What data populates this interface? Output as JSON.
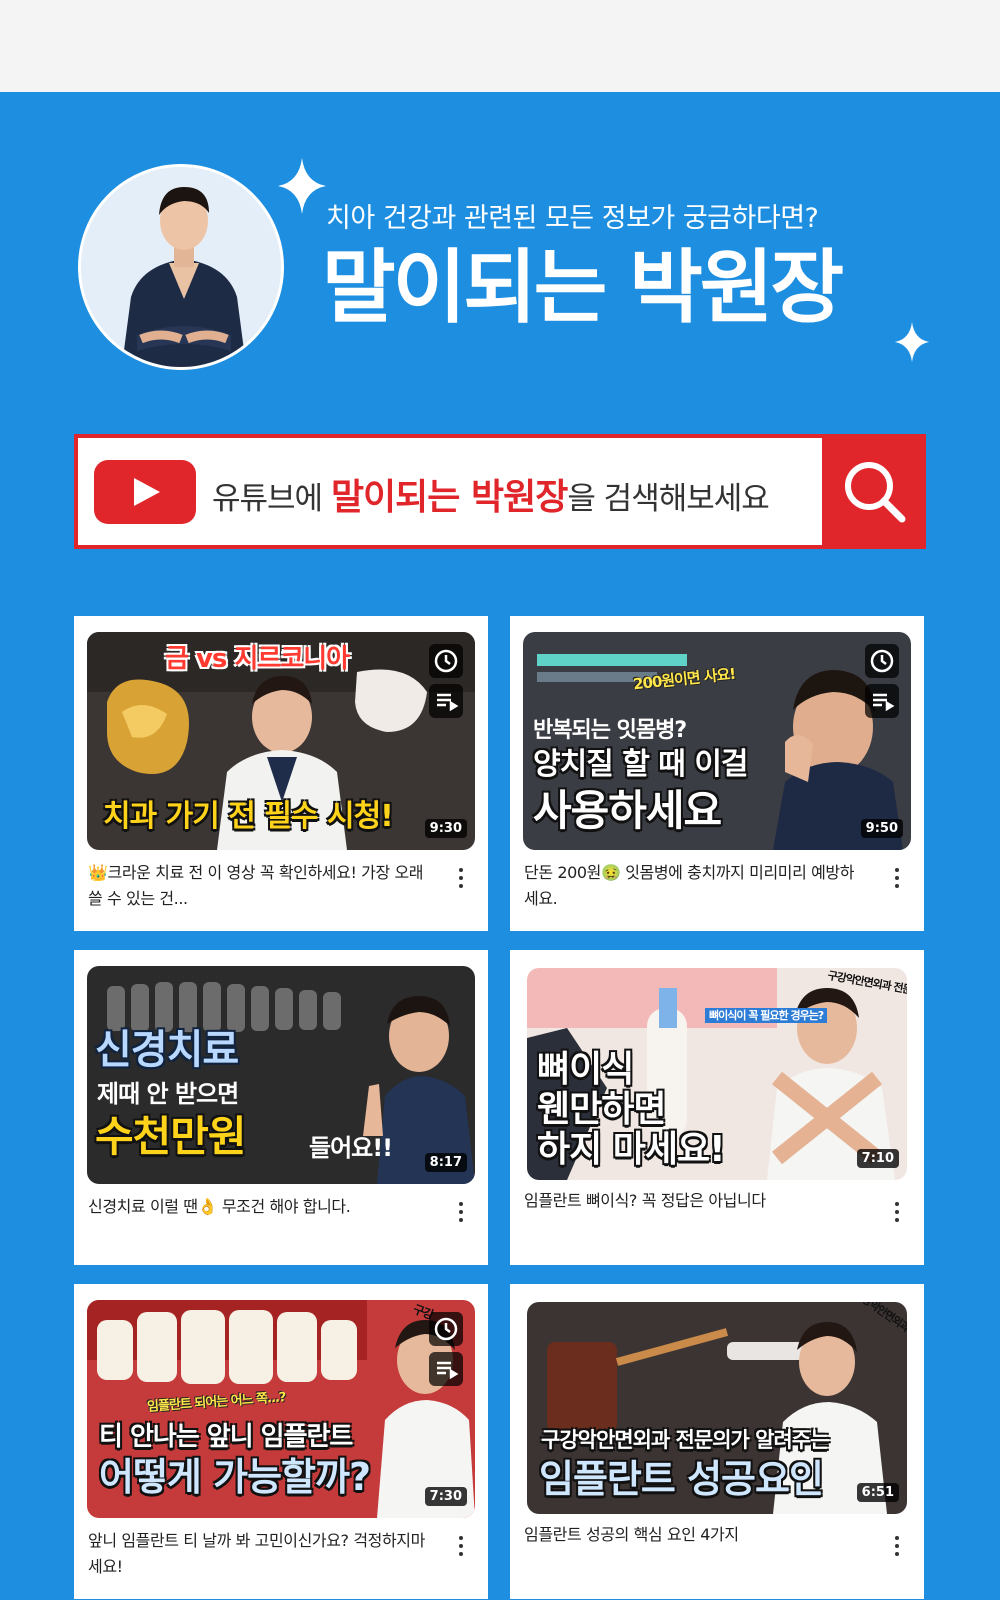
{
  "header": {
    "subtitle": "치아 건강과 관련된 모든 정보가 궁금하다면?",
    "title": "말이되는 박원장"
  },
  "search": {
    "prefix": "유튜브에 ",
    "highlight": "말이되는 박원장",
    "suffix": "을 검색해보세요"
  },
  "colors": {
    "background": "#1e8fe0",
    "accent": "#e0262b"
  },
  "videos": [
    {
      "duration": "9:30",
      "caption": "👑크라운 치료 전 이 영상 꼭 확인하세요! 가장 오래 쓸 수 있는 건...",
      "thumb_lines": [
        "금 vs 지르코니아",
        "치과 가기 전 필수 시청!"
      ]
    },
    {
      "duration": "9:50",
      "caption": "단돈 200원🤢 잇몸병에 충치까지 미리미리 예방하세요.",
      "thumb_lines": [
        "200원이면 사요!",
        "반복되는 잇몸병?",
        "양치질 할 때 이걸",
        "사용하세요"
      ]
    },
    {
      "duration": "8:17",
      "caption": "신경치료 이럴 땐👌 무조건 해야 합니다.",
      "thumb_lines": [
        "신경치료",
        "제때 안 받으면",
        "수천만원",
        "들어요!!"
      ]
    },
    {
      "duration": "7:10",
      "caption": "임플란트 뼈이식? 꼭 정답은 아닙니다",
      "thumb_lines": [
        "구강악안면외과 전문의",
        "뼈이식이 꼭 필요한 경우는?",
        "뼈이식",
        "웬만하면",
        "하지 마세요!"
      ]
    },
    {
      "duration": "7:30",
      "caption": "앞니 임플란트 티 날까 봐 고민이신가요? 걱정하지마세요!",
      "thumb_lines": [
        "구강",
        "임플란트 되어는 어느 쪽...?",
        "티 안나는 앞니 임플란트",
        "어떻게 가능할까?"
      ]
    },
    {
      "duration": "6:51",
      "caption": "임플란트 성공의 핵심 요인 4가지",
      "thumb_lines": [
        "구강악안면외과 전문의",
        "구강악안면외과 전문의가 알려주는",
        "임플란트 성공요인"
      ]
    }
  ]
}
